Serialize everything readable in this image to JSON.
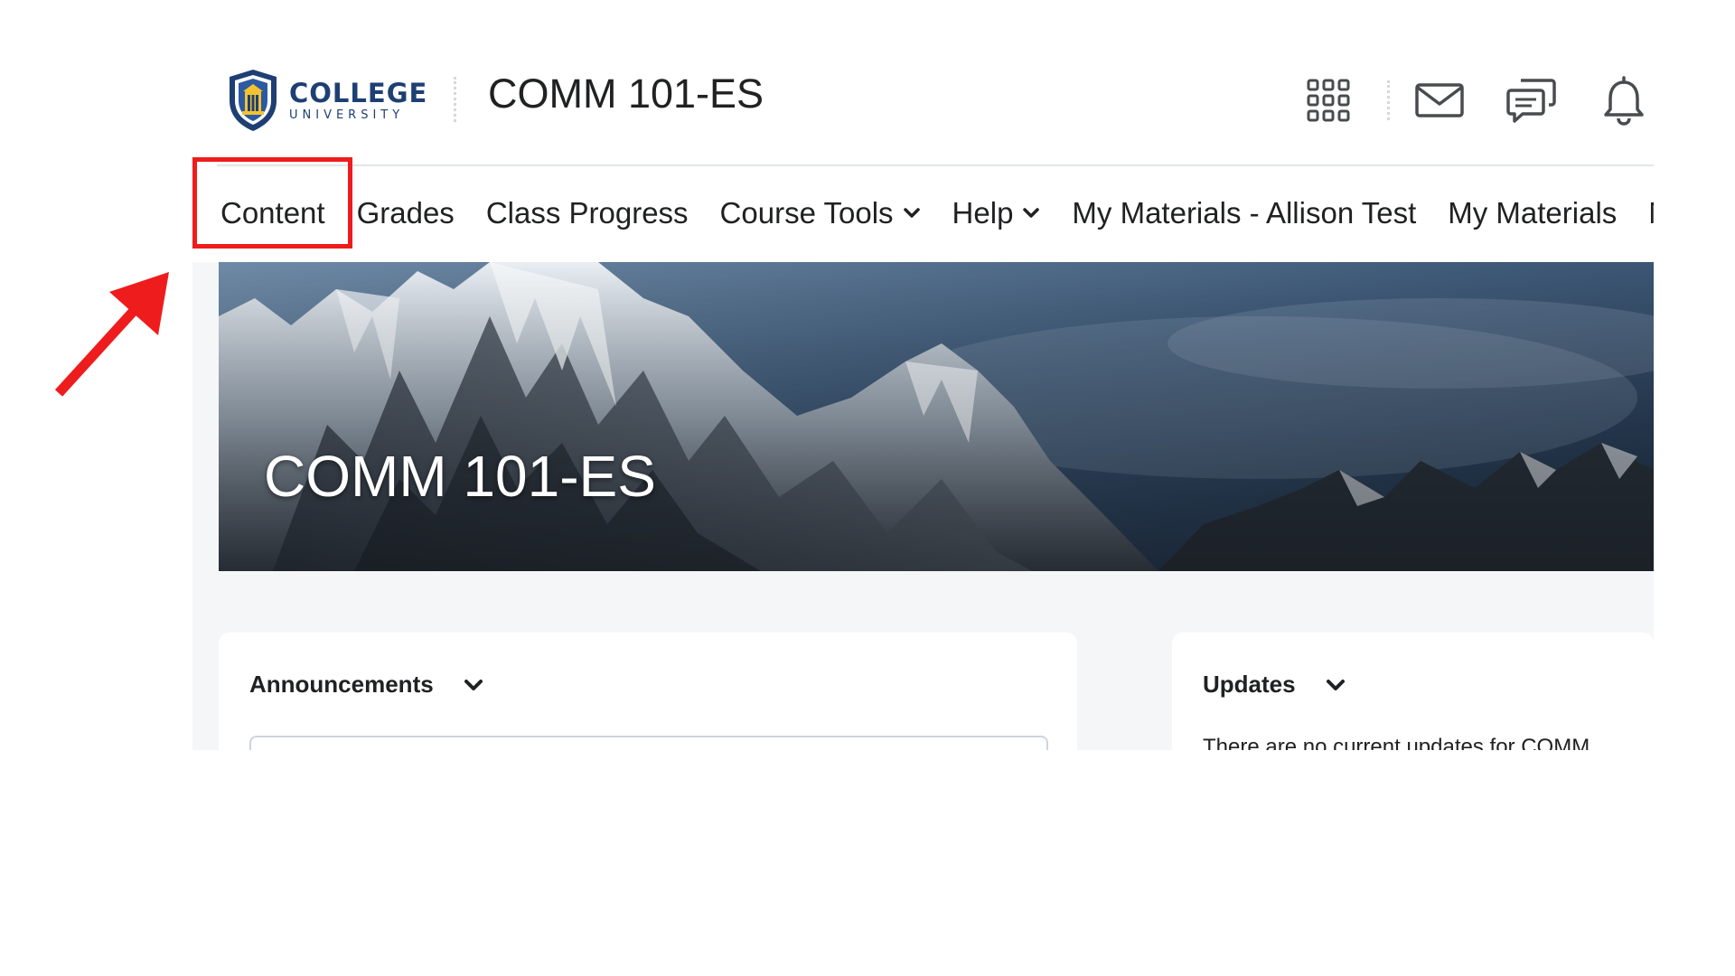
{
  "header": {
    "logo": {
      "name": "COLLEGE",
      "subtitle": "UNIVERSITY"
    },
    "course_title": "COMM 101-ES",
    "icons": [
      "app-grid-icon",
      "mail-icon",
      "chat-icon",
      "bell-icon"
    ]
  },
  "navbar": {
    "items": [
      {
        "label": "Content",
        "highlighted": true
      },
      {
        "label": "Grades"
      },
      {
        "label": "Class Progress"
      },
      {
        "label": "Course Tools",
        "dropdown": true
      },
      {
        "label": "Help",
        "dropdown": true
      },
      {
        "label": "My Materials - Allison Test"
      },
      {
        "label": "My Materials"
      },
      {
        "label": "M"
      }
    ]
  },
  "banner": {
    "title": "COMM 101-ES"
  },
  "widgets": {
    "announcements": {
      "title": "Announcements"
    },
    "updates": {
      "title": "Updates",
      "message": "There are no current updates for COMM"
    }
  },
  "colors": {
    "brand": "#1e3f73",
    "highlight": "#ee1c1c",
    "text": "#202122",
    "page_bg": "#f5f6f8"
  }
}
